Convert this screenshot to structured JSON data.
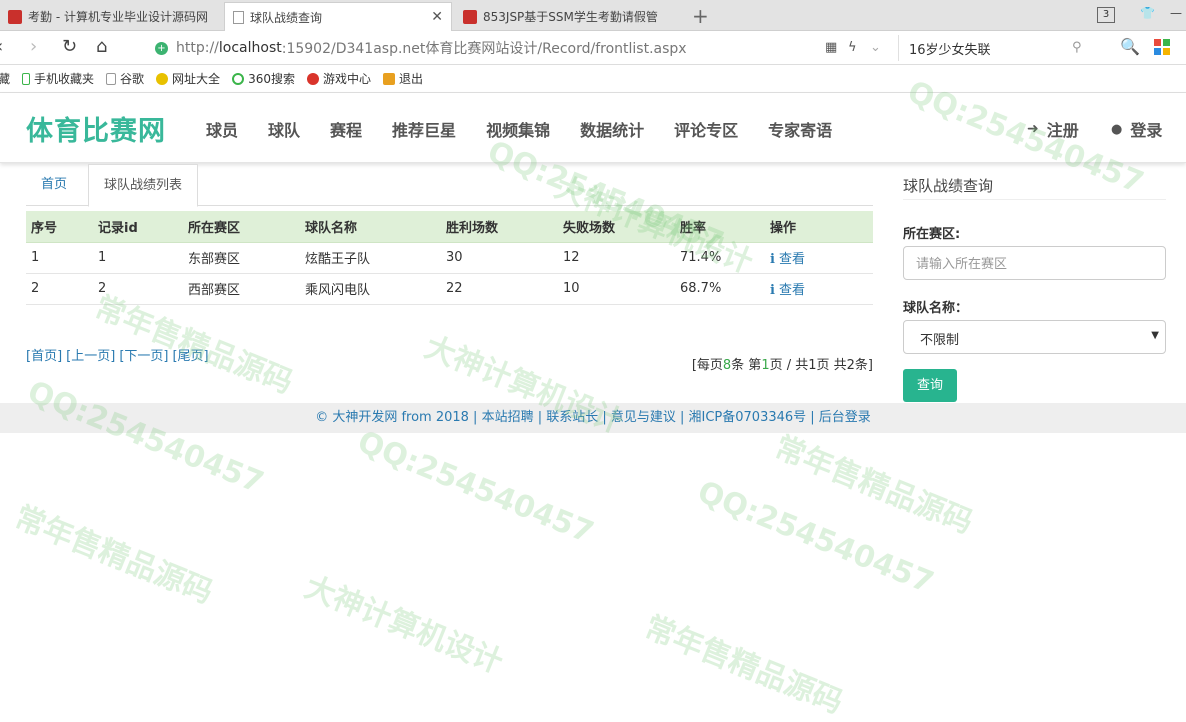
{
  "browser": {
    "tabs": [
      {
        "title": "考勤 - 计算机专业毕业设计源码网",
        "active": false
      },
      {
        "title": "球队战绩查询",
        "active": true
      },
      {
        "title": "853JSP基于SSM学生考勤请假管",
        "active": false
      }
    ],
    "tab_count": "3",
    "url_prefix": "http://",
    "url_host": "localhost",
    "url_rest": ":15902/D341asp.net体育比赛网站设计/Record/frontlist.aspx",
    "search_text": "16岁少女失联",
    "bookmarks": [
      "藏",
      "手机收藏夹",
      "谷歌",
      "网址大全",
      "360搜索",
      "游戏中心",
      "退出"
    ]
  },
  "site": {
    "logo": "体育比赛网",
    "nav": [
      "球员",
      "球队",
      "赛程",
      "推荐巨星",
      "视频集锦",
      "数据统计",
      "评论专区",
      "专家寄语"
    ],
    "register": "注册",
    "login": "登录"
  },
  "breadcrumb": {
    "home": "首页",
    "current": "球队战绩列表"
  },
  "table": {
    "headers": [
      "序号",
      "记录id",
      "所在赛区",
      "球队名称",
      "胜利场数",
      "失败场数",
      "胜率",
      "操作"
    ],
    "rows": [
      [
        "1",
        "1",
        "东部赛区",
        "炫酷王子队",
        "30",
        "12",
        "71.4%",
        "查看"
      ],
      [
        "2",
        "2",
        "西部赛区",
        "乘风闪电队",
        "22",
        "10",
        "68.7%",
        "查看"
      ]
    ]
  },
  "pager": {
    "first": "[首页]",
    "prev": "[上一页]",
    "next": "[下一页]",
    "last": "[尾页]",
    "info_a": "[每页",
    "per_page": "8",
    "info_b": "条 第",
    "page": "1",
    "info_c": "页 / 共1页 共2条]"
  },
  "footer": "© 大神开发网 from 2018 | 本站招聘 | 联系站长 | 意见与建议 | 湘ICP备0703346号 | 后台登录",
  "search_panel": {
    "title": "球队战绩查询",
    "region_label": "所在赛区:",
    "region_placeholder": "请输入所在赛区",
    "team_label": "球队名称：",
    "team_selected": "不限制",
    "submit": "查询"
  },
  "watermarks": [
    "QQ:254540457",
    "常年售精品源码",
    "大神计算机设计"
  ],
  "colors": {
    "brand": "#39b89a",
    "table_header": "#dff0d8",
    "link": "#2a7ab0",
    "button": "#28b48f"
  }
}
